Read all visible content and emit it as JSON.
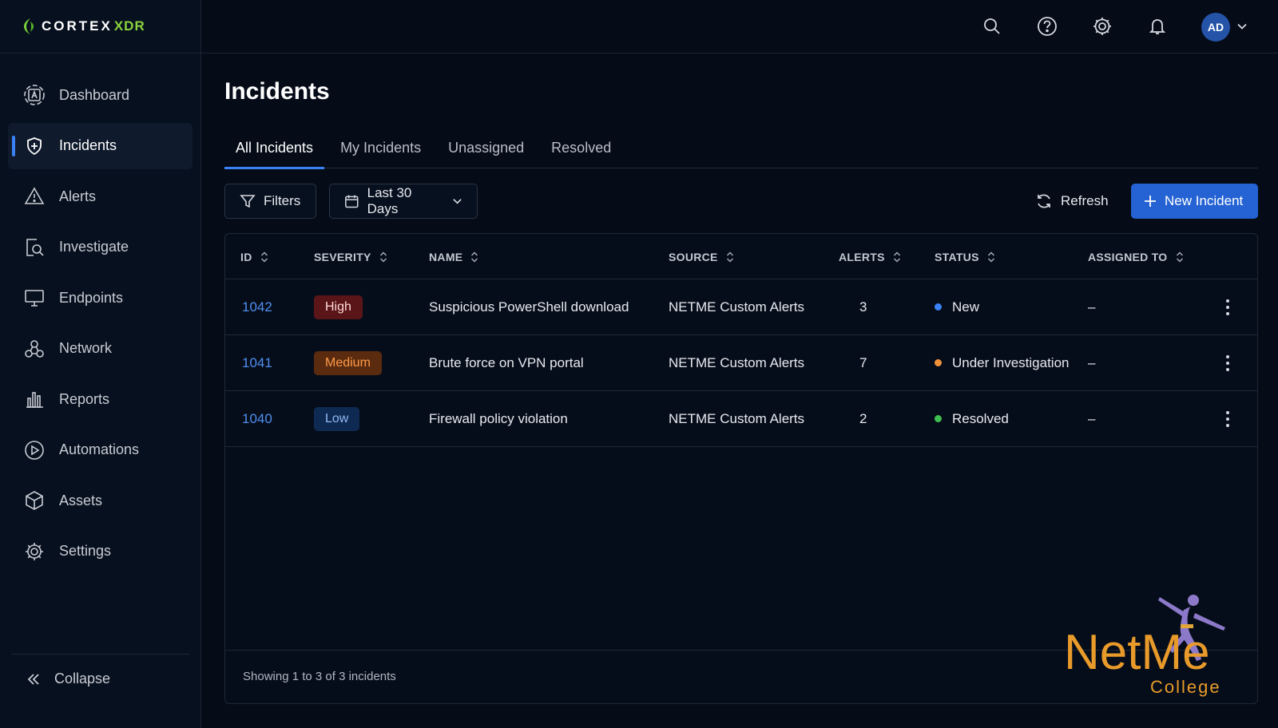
{
  "brand": {
    "name": "CORTEX",
    "suffix": "XDR"
  },
  "sidebar": {
    "items": [
      {
        "label": "Dashboard",
        "icon": "dashboard-icon"
      },
      {
        "label": "Incidents",
        "icon": "shield-icon",
        "active": true
      },
      {
        "label": "Alerts",
        "icon": "warning-icon"
      },
      {
        "label": "Investigate",
        "icon": "investigate-icon"
      },
      {
        "label": "Endpoints",
        "icon": "monitor-icon"
      },
      {
        "label": "Network",
        "icon": "network-icon"
      },
      {
        "label": "Reports",
        "icon": "bar-chart-icon"
      },
      {
        "label": "Automations",
        "icon": "play-icon"
      },
      {
        "label": "Assets",
        "icon": "cube-icon"
      },
      {
        "label": "Settings",
        "icon": "gear-icon"
      }
    ],
    "collapse_label": "Collapse"
  },
  "topbar": {
    "icons": [
      "search-icon",
      "help-icon",
      "gear-icon",
      "bell-icon"
    ],
    "avatar_initials": "AD"
  },
  "page": {
    "title": "Incidents",
    "tabs": [
      {
        "label": "All Incidents",
        "active": true
      },
      {
        "label": "My Incidents"
      },
      {
        "label": "Unassigned"
      },
      {
        "label": "Resolved"
      }
    ]
  },
  "toolbar": {
    "filters_label": "Filters",
    "date_range": "Last 30 Days",
    "refresh_label": "Refresh",
    "new_incident_label": "New Incident"
  },
  "table": {
    "columns": [
      "ID",
      "SEVERITY",
      "NAME",
      "SOURCE",
      "ALERTS",
      "STATUS",
      "ASSIGNED TO"
    ],
    "rows": [
      {
        "id": "1042",
        "severity": "High",
        "name": "Suspicious PowerShell download",
        "source": "NETME Custom Alerts",
        "alerts": "3",
        "status": "New",
        "assigned": "–"
      },
      {
        "id": "1041",
        "severity": "Medium",
        "name": "Brute force on VPN portal",
        "source": "NETME Custom Alerts",
        "alerts": "7",
        "status": "Under Investigation",
        "assigned": "–"
      },
      {
        "id": "1040",
        "severity": "Low",
        "name": "Firewall policy violation",
        "source": "NETME Custom Alerts",
        "alerts": "2",
        "status": "Resolved",
        "assigned": "–"
      }
    ],
    "footer": "Showing 1 to 3 of 3 incidents"
  },
  "colors": {
    "accent": "#2563d4",
    "status_new": "#3b82f6",
    "status_investigation": "#f0913a",
    "status_resolved": "#3fbf4f"
  },
  "watermark": {
    "line1": "NetMe",
    "line2": "College"
  }
}
